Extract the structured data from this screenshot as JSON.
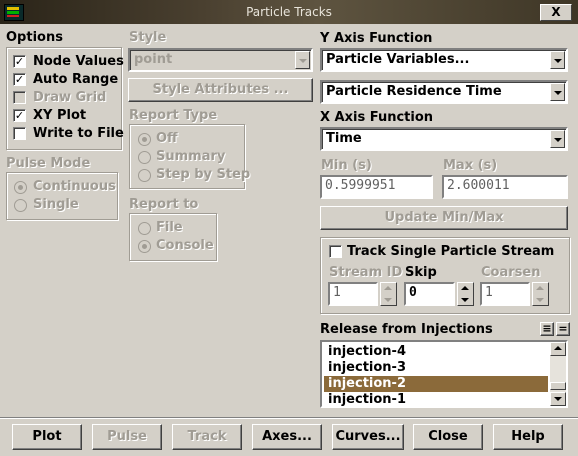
{
  "window": {
    "title": "Particle Tracks",
    "close_label": "X"
  },
  "options": {
    "title": "Options",
    "items": [
      {
        "label": "Node Values",
        "checked": true,
        "enabled": true
      },
      {
        "label": "Auto Range",
        "checked": true,
        "enabled": true
      },
      {
        "label": "Draw Grid",
        "checked": false,
        "enabled": false
      },
      {
        "label": "XY Plot",
        "checked": true,
        "enabled": true
      },
      {
        "label": "Write to File",
        "checked": false,
        "enabled": true
      }
    ]
  },
  "pulse_mode": {
    "title": "Pulse Mode",
    "options": [
      "Continuous",
      "Single"
    ],
    "selected": "Continuous"
  },
  "style": {
    "title": "Style",
    "value": "point",
    "attributes_button": "Style Attributes ..."
  },
  "report_type": {
    "title": "Report Type",
    "options": [
      "Off",
      "Summary",
      "Step by Step"
    ],
    "selected": "Off"
  },
  "report_to": {
    "title": "Report to",
    "options": [
      "File",
      "Console"
    ],
    "selected": "Console"
  },
  "y_axis": {
    "title": "Y Axis Function",
    "category": "Particle Variables...",
    "variable": "Particle Residence Time"
  },
  "x_axis": {
    "title": "X Axis Function",
    "value": "Time"
  },
  "range": {
    "min_label": "Min (s)",
    "min_value": "0.5999951",
    "max_label": "Max (s)",
    "max_value": "2.600011",
    "update_button": "Update Min/Max"
  },
  "track_single": {
    "label": "Track Single Particle Stream",
    "checked": false,
    "stream_id_label": "Stream ID",
    "stream_id_value": "1",
    "skip_label": "Skip",
    "skip_value": "0",
    "coarsen_label": "Coarsen",
    "coarsen_value": "1"
  },
  "release": {
    "title": "Release from Injections",
    "select_all_icon": "≡",
    "deselect_icon": "=",
    "items": [
      "injection-4",
      "injection-3",
      "injection-2",
      "injection-1"
    ],
    "selected": "injection-2"
  },
  "buttons": {
    "plot": "Plot",
    "pulse": "Pulse",
    "track": "Track",
    "axes": "Axes...",
    "curves": "Curves...",
    "close": "Close",
    "help": "Help"
  },
  "colors": {
    "face": "#d4d0c8",
    "selection": "#8b6a3a",
    "titlebar": "#4a4030"
  }
}
